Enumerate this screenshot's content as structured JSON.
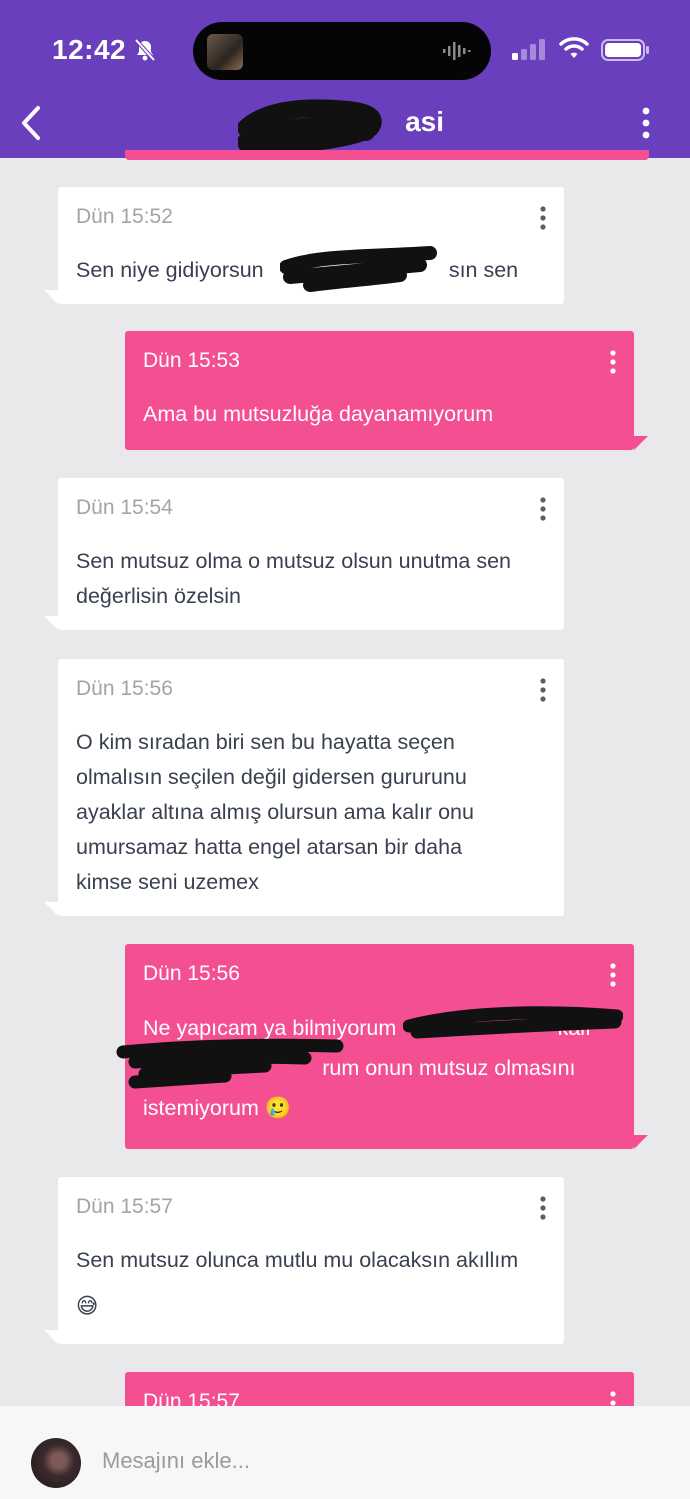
{
  "status_bar": {
    "time": "12:42",
    "icons": [
      "bell-slash-icon",
      "now-playing-art",
      "audio-wave-icon",
      "cellular-signal-icon",
      "wifi-icon",
      "battery-icon"
    ]
  },
  "header": {
    "title": "asi",
    "back_icon": "chevron-left-icon",
    "menu_icon": "vertical-ellipsis-icon",
    "background": "#6a3fbd"
  },
  "colors": {
    "incoming_bubble": "#ffffff",
    "outgoing_bubble": "#f44f93",
    "chat_background": "#e9e9ec",
    "incoming_text": "#394050",
    "timestamp_text": "#a2a4aa"
  },
  "messages": [
    {
      "direction": "incoming",
      "time": "Dün 15:52",
      "text": "Sen niye gidiyorsun                               sın sen"
    },
    {
      "direction": "outgoing",
      "time": "Dün 15:53",
      "text": "Ama bu mutsuzluğa dayanamıyorum"
    },
    {
      "direction": "incoming",
      "time": "Dün 15:54",
      "text": "Sen mutsuz olma o mutsuz olsun unutma sen\ndeğerlisin özelsin"
    },
    {
      "direction": "incoming",
      "time": "Dün 15:56",
      "text": "O kim sıradan biri sen bu hayatta seçen\nolmalısın seçilen değil gidersen gururunu\nayaklar altına almış olursun ama kalır onu\numursamaz hatta engel atarsan bir daha\nkimse seni uzemex"
    },
    {
      "direction": "outgoing",
      "time": "Dün 15:56",
      "text": "Ne yapıcam ya bilmiyorum                           kalı\n                              rum onun mutsuz olmasını\nistemiyorum 🥲"
    },
    {
      "direction": "incoming",
      "time": "Dün 15:57",
      "text": "Sen mutsuz olunca mutlu mu olacaksın akıllım\n😅"
    },
    {
      "direction": "outgoing",
      "time": "Dün 15:57",
      "text": ""
    }
  ],
  "composer": {
    "placeholder": "Mesajını ekle...",
    "value": ""
  }
}
